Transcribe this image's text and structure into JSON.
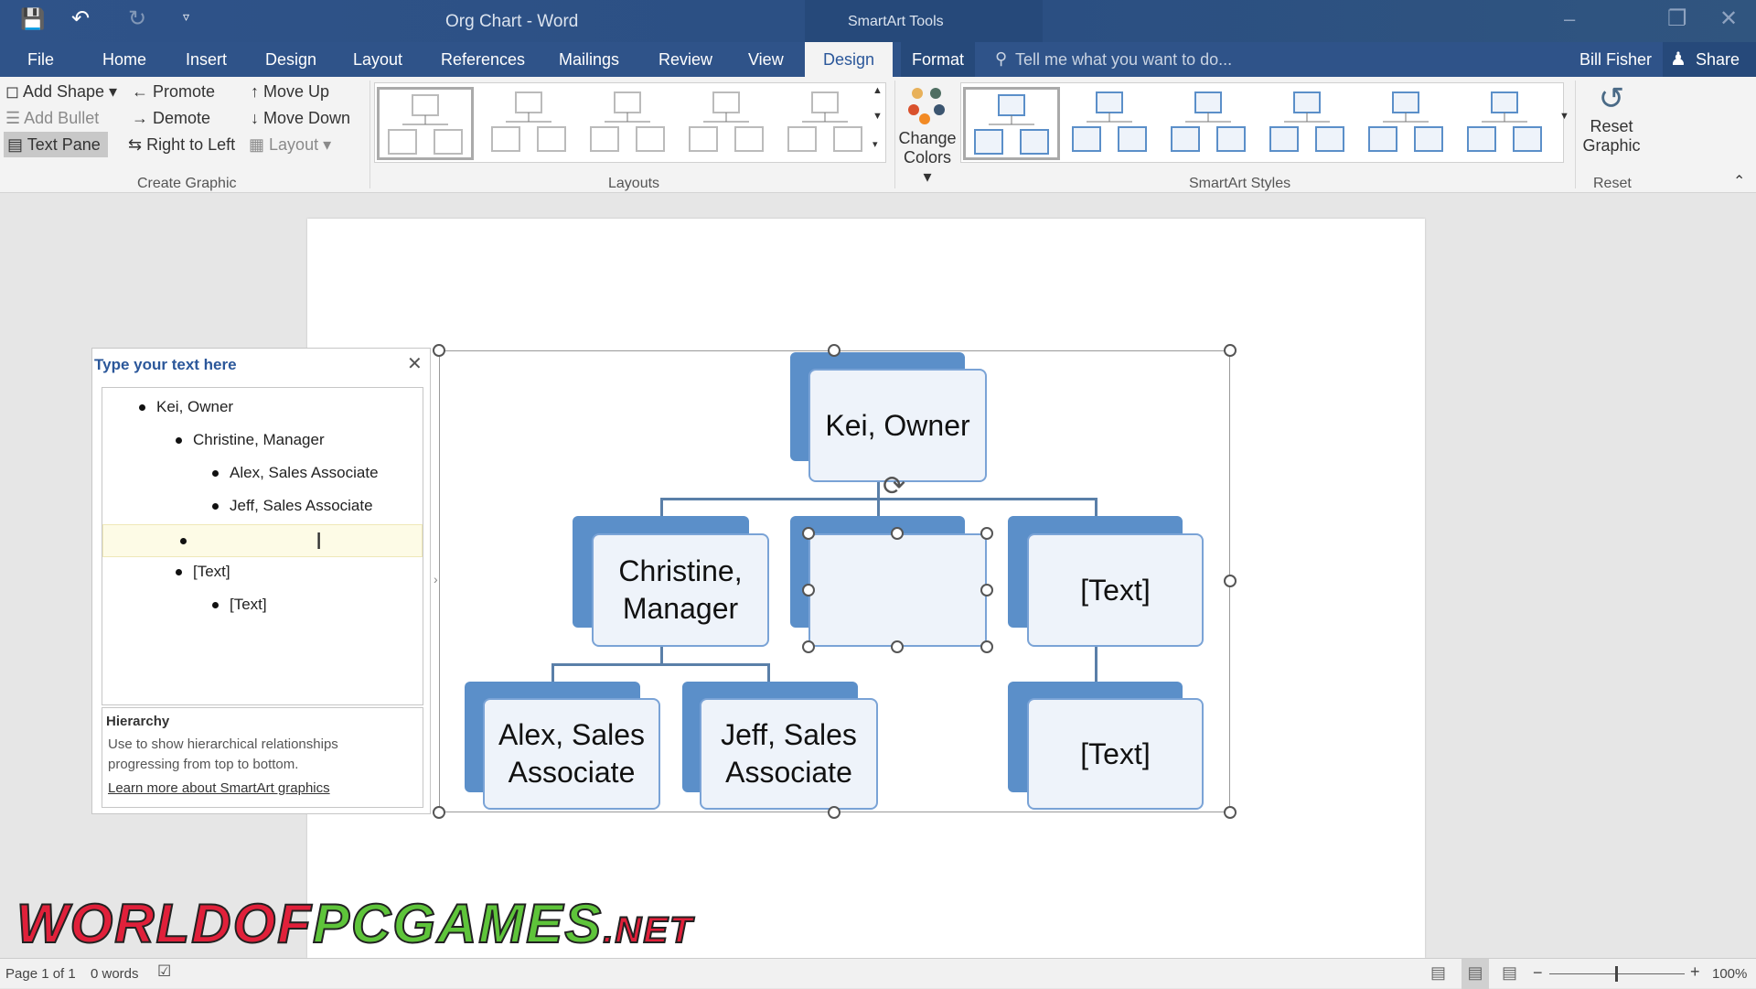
{
  "window": {
    "title": "Org Chart - Word",
    "context_tools": "SmartArt Tools",
    "user": "Bill Fisher",
    "share": "Share"
  },
  "tabs": [
    "File",
    "Home",
    "Insert",
    "Design",
    "Layout",
    "References",
    "Mailings",
    "Review",
    "View",
    "Design",
    "Format"
  ],
  "active_tab": "Design",
  "tell_me": "Tell me what you want to do...",
  "ribbon": {
    "create_graphic": {
      "label": "Create Graphic",
      "add_shape": "Add Shape",
      "add_bullet": "Add Bullet",
      "text_pane": "Text Pane",
      "promote": "Promote",
      "demote": "Demote",
      "right_to_left": "Right to Left",
      "move_up": "Move Up",
      "move_down": "Move Down",
      "layout": "Layout"
    },
    "layouts": {
      "label": "Layouts"
    },
    "smartart_styles": {
      "label": "SmartArt Styles",
      "change_colors_1": "Change",
      "change_colors_2": "Colors"
    },
    "reset": {
      "label": "Reset",
      "reset_graphic_1": "Reset",
      "reset_graphic_2": "Graphic"
    }
  },
  "text_pane": {
    "title": "Type your text here",
    "items": [
      {
        "text": "Kei, Owner",
        "level": 1
      },
      {
        "text": "Christine, Manager",
        "level": 2
      },
      {
        "text": "Alex, Sales Associate",
        "level": 3
      },
      {
        "text": "Jeff, Sales Associate",
        "level": 3
      },
      {
        "text": "",
        "level": 2
      },
      {
        "text": "[Text]",
        "level": 2
      },
      {
        "text": "[Text]",
        "level": 3
      }
    ],
    "info_title": "Hierarchy",
    "info_desc": "Use to show hierarchical relationships progressing from top to bottom.",
    "learn_more": "Learn more about SmartArt graphics"
  },
  "org_chart": {
    "top": "Kei, Owner",
    "level2": [
      "Christine, Manager",
      "",
      "[Text]"
    ],
    "level3_christine": [
      "Alex, Sales Associate",
      "Jeff, Sales Associate"
    ],
    "level3_right": "[Text]"
  },
  "watermark": "WORLDOFPCGAMES.NET",
  "status": {
    "page": "Page 1 of 1",
    "words": "0 words",
    "zoom": "100%"
  },
  "colors": {
    "accent": "#2b579a",
    "shape_fill": "#5b8fc9",
    "shape_border": "#7aa3d6"
  }
}
